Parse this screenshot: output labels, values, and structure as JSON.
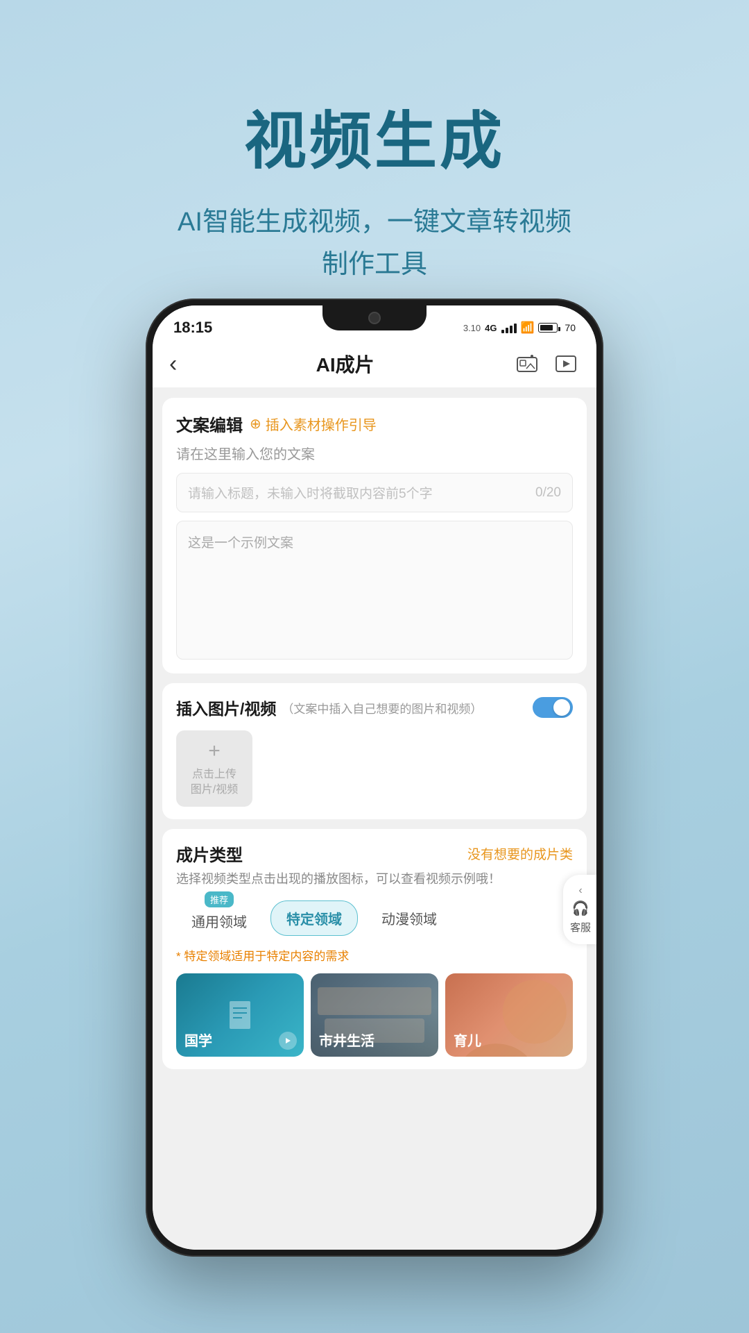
{
  "page": {
    "background": "linear-gradient(160deg, #b8d8e8 0%, #c5e0ed 30%, #a8cfe0 60%, #9ec5d8 100%)",
    "main_title": "视频生成",
    "subtitle_line1": "AI智能生成视频，一键文章转视频",
    "subtitle_line2": "制作工具"
  },
  "phone": {
    "status_bar": {
      "time": "18:15",
      "network_speed": "3.10",
      "battery": "70"
    },
    "app_bar": {
      "back_icon": "‹",
      "title": "AI成片",
      "photo_icon": "⊞",
      "play_icon": "▷"
    },
    "section_copywriting": {
      "title": "文案编辑",
      "insert_guide_icon": "⊕",
      "insert_guide_text": "插入素材操作引导",
      "desc": "请在这里输入您的文案",
      "title_input_placeholder": "请输入标题，未输入时将截取内容前5个字",
      "title_input_count": "0/20",
      "content_placeholder": "这是一个示例文案"
    },
    "section_media": {
      "title": "插入图片/视频",
      "subtitle": "（文案中插入自己想要的图片和视频）",
      "toggle_on": true,
      "upload_plus": "+",
      "upload_text": "点击上传\n图片/视频"
    },
    "section_type": {
      "title": "成片类型",
      "link_text": "没有想要的成片类",
      "desc": "选择视频类型点击出现的播放图标，可以查看视频示例哦！",
      "tabs": [
        {
          "label": "通用领域",
          "active": false,
          "badge": "推荐"
        },
        {
          "label": "特定领域",
          "active": true,
          "badge": null
        },
        {
          "label": "动漫领域",
          "active": false,
          "badge": null
        }
      ],
      "note": "特定领域适用于特定内容的需求",
      "categories": [
        {
          "label": "国学",
          "has_play": true,
          "color": "guoxue"
        },
        {
          "label": "市井生活",
          "has_play": false,
          "color": "shijing"
        },
        {
          "label": "育儿",
          "has_play": false,
          "color": "yuer"
        }
      ]
    },
    "float_service": {
      "icon": "◉",
      "text": "客服",
      "chevron": "‹"
    }
  }
}
